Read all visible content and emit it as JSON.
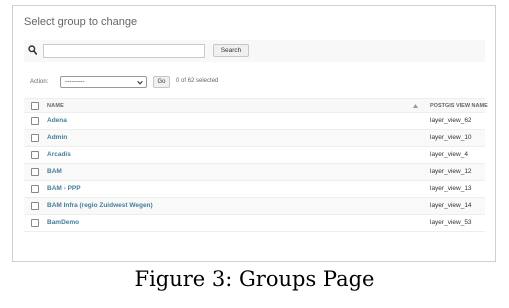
{
  "header": {
    "title": "Select group to change"
  },
  "search": {
    "value": "",
    "placeholder": "",
    "button_label": "Search"
  },
  "actions": {
    "label": "Action:",
    "selected_value": "---------",
    "go_label": "Go",
    "selected_count": "0 of 62 selected"
  },
  "table": {
    "columns": [
      "NAME",
      "POSTGIS VIEW NAME"
    ],
    "rows": [
      {
        "name": "Adena",
        "layer_view": "layer_view_62"
      },
      {
        "name": "Admin",
        "layer_view": "layer_view_10"
      },
      {
        "name": "Arcadis",
        "layer_view": "layer_view_4"
      },
      {
        "name": "BAM",
        "layer_view": "layer_view_12"
      },
      {
        "name": "BAM - PPP",
        "layer_view": "layer_view_13"
      },
      {
        "name": "BAM Infra (regio Zuidwest Wegen)",
        "layer_view": "layer_view_14"
      },
      {
        "name": "BamDemo",
        "layer_view": "layer_view_53"
      }
    ]
  },
  "caption": "Figure 3: Groups Page",
  "colors": {
    "link": "#447e9b",
    "header_bg": "#f8f8f8"
  },
  "icons": {
    "search": "search-icon",
    "dropdown": "chevron-down-icon",
    "sort": "sort-ascending-icon"
  }
}
